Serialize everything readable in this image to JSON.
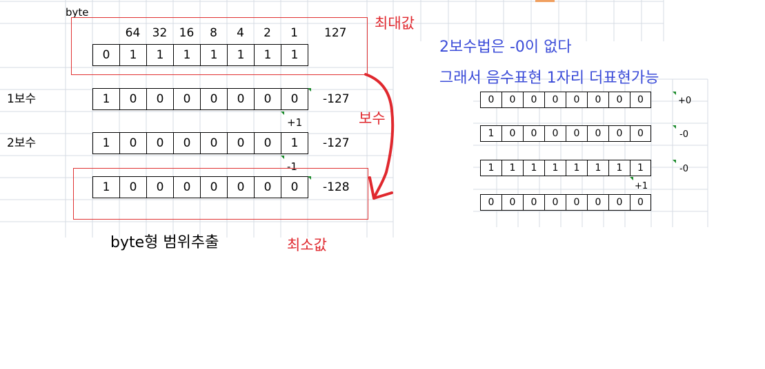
{
  "left_sheet": {
    "type_label": "byte",
    "bit_weights": [
      "64",
      "32",
      "16",
      "8",
      "4",
      "2",
      "1"
    ],
    "max_value_header": "127",
    "rows": [
      {
        "label": "",
        "bits": [
          "0",
          "1",
          "1",
          "1",
          "1",
          "1",
          "1",
          "1"
        ],
        "value": ""
      },
      {
        "label": "1보수",
        "bits": [
          "1",
          "0",
          "0",
          "0",
          "0",
          "0",
          "0",
          "0"
        ],
        "value": "-127"
      },
      {
        "label": "2보수",
        "bits": [
          "1",
          "0",
          "0",
          "0",
          "0",
          "0",
          "0",
          "1"
        ],
        "value": "-127"
      },
      {
        "label": "",
        "bits": [
          "1",
          "0",
          "0",
          "0",
          "0",
          "0",
          "0",
          "0"
        ],
        "value": "-128"
      }
    ],
    "plus_one": "+1",
    "minus_one": "-1",
    "caption": "byte형 범위추출"
  },
  "annotations": {
    "max_label": "최대값",
    "complement_label": "보수",
    "min_label": "최소값",
    "note_line1": "2보수법은 -0이 없다",
    "note_line2": "그래서 음수표현 1자리 더표현가능"
  },
  "right_sheet": {
    "rows": [
      {
        "bits": [
          "0",
          "0",
          "0",
          "0",
          "0",
          "0",
          "0",
          "0"
        ],
        "value": "+0"
      },
      {
        "bits": [
          "1",
          "0",
          "0",
          "0",
          "0",
          "0",
          "0",
          "0"
        ],
        "value": "-0"
      },
      {
        "bits": [
          "1",
          "1",
          "1",
          "1",
          "1",
          "1",
          "1",
          "1"
        ],
        "value": "-0"
      },
      {
        "bits": [
          "0",
          "0",
          "0",
          "0",
          "0",
          "0",
          "0",
          "0"
        ],
        "value": ""
      }
    ],
    "plus_one": "+1"
  },
  "colors": {
    "annotation_red": "#e0282e",
    "annotation_blue": "#3a4bd8",
    "grid_line": "#d6dbe3",
    "comment_marker": "#1a8a2a"
  }
}
